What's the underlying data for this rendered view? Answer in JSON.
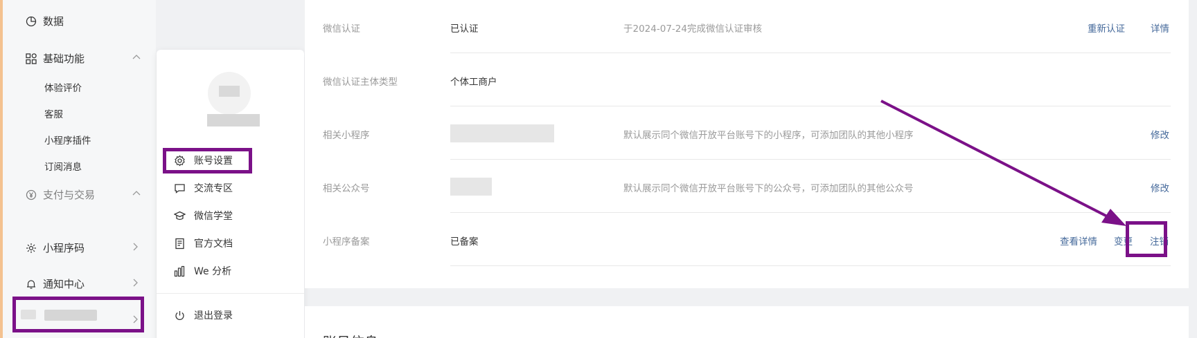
{
  "sidebar": {
    "items": [
      {
        "label": "数据",
        "icon": "chart-pie-icon"
      },
      {
        "label": "基础功能",
        "icon": "grid-apps-icon"
      },
      {
        "label": "支付与交易",
        "icon": "yuan-coin-icon"
      },
      {
        "label": "小程序码",
        "icon": "sun-code-icon"
      },
      {
        "label": "通知中心",
        "icon": "bell-icon"
      }
    ],
    "sub_items": [
      "体验评价",
      "客服",
      "小程序插件",
      "订阅消息"
    ]
  },
  "popup": {
    "menu": [
      {
        "label": "账号设置",
        "icon": "gear-icon"
      },
      {
        "label": "交流专区",
        "icon": "chat-bubble-icon"
      },
      {
        "label": "微信学堂",
        "icon": "graduation-cap-icon"
      },
      {
        "label": "官方文档",
        "icon": "document-icon"
      },
      {
        "label": "We 分析",
        "icon": "bar-analytics-icon"
      }
    ],
    "logout_label": "退出登录"
  },
  "rows": [
    {
      "label": "微信认证",
      "value": "已认证",
      "desc": "于2024-07-24完成微信认证审核",
      "actions": [
        "重新认证",
        "详情"
      ]
    },
    {
      "label": "微信认证主体类型",
      "value": "个体工商户",
      "desc": "",
      "actions": []
    },
    {
      "label": "相关小程序",
      "value": "",
      "desc": "默认展示同个微信开放平台账号下的小程序，可添加团队的其他小程序",
      "actions": [
        "修改"
      ]
    },
    {
      "label": "相关公众号",
      "value": "",
      "desc": "默认展示同个微信开放平台账号下的公众号，可添加团队的其他公众号",
      "actions": [
        "修改"
      ]
    },
    {
      "label": "小程序备案",
      "value": "已备案",
      "desc": "",
      "actions": [
        "查看详情",
        "变更",
        "注销"
      ]
    }
  ],
  "section2": {
    "title": "账号信息"
  },
  "colors": {
    "highlight": "#7b1188",
    "link": "#466a9b",
    "accent_strip": "#f4c290"
  }
}
